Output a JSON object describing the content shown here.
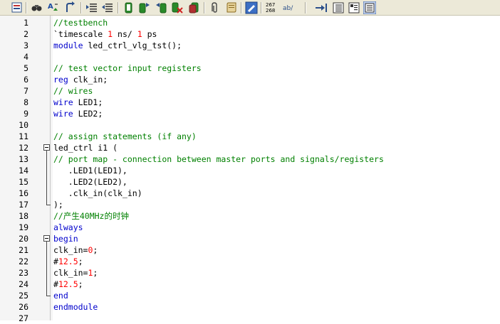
{
  "toolbar": {
    "buttons": [
      {
        "name": "insert-template-icon"
      },
      {
        "name": "find-icon"
      },
      {
        "name": "find-replace-icon"
      },
      {
        "name": "goto-line-icon"
      },
      {
        "name": "indent-icon"
      },
      {
        "name": "unindent-icon"
      },
      {
        "name": "bookmark-toggle-icon"
      },
      {
        "name": "bookmark-next-icon"
      },
      {
        "name": "bookmark-prev-icon"
      },
      {
        "name": "bookmark-clear-icon"
      },
      {
        "name": "bookmark-list-icon"
      },
      {
        "name": "attach-icon"
      },
      {
        "name": "scroll-icon"
      },
      {
        "name": "edit-icon"
      },
      {
        "name": "line-numbers-icon",
        "text_top": "267",
        "text_bottom": "268"
      },
      {
        "name": "whitespace-icon",
        "text": "ab/"
      },
      {
        "name": "comment-icon"
      },
      {
        "name": "uncomment-icon"
      },
      {
        "name": "expand-icon"
      },
      {
        "name": "collapse-icon"
      }
    ]
  },
  "editor": {
    "lines": [
      {
        "n": "1",
        "parts": [
          {
            "t": "//testbench",
            "c": "cm"
          }
        ]
      },
      {
        "n": "2",
        "parts": [
          {
            "t": "`timescale ",
            "c": ""
          },
          {
            "t": "1",
            "c": "num"
          },
          {
            "t": " ns/ ",
            "c": ""
          },
          {
            "t": "1",
            "c": "num"
          },
          {
            "t": " ps",
            "c": ""
          }
        ]
      },
      {
        "n": "3",
        "parts": [
          {
            "t": "module",
            "c": "kw"
          },
          {
            "t": " led_ctrl_vlg_tst();",
            "c": ""
          }
        ]
      },
      {
        "n": "4",
        "parts": []
      },
      {
        "n": "5",
        "parts": [
          {
            "t": "// test vector input registers",
            "c": "cm"
          }
        ]
      },
      {
        "n": "6",
        "parts": [
          {
            "t": "reg",
            "c": "kw"
          },
          {
            "t": " clk_in;",
            "c": ""
          }
        ]
      },
      {
        "n": "7",
        "parts": [
          {
            "t": "// wires",
            "c": "cm"
          }
        ]
      },
      {
        "n": "8",
        "parts": [
          {
            "t": "wire",
            "c": "kw"
          },
          {
            "t": " LED1;",
            "c": ""
          }
        ]
      },
      {
        "n": "9",
        "parts": [
          {
            "t": "wire",
            "c": "kw"
          },
          {
            "t": " LED2;",
            "c": ""
          }
        ]
      },
      {
        "n": "10",
        "parts": []
      },
      {
        "n": "11",
        "parts": [
          {
            "t": "// assign statements (if any)",
            "c": "cm"
          }
        ]
      },
      {
        "n": "12",
        "parts": [
          {
            "t": "led_ctrl i1 (",
            "c": ""
          }
        ]
      },
      {
        "n": "13",
        "parts": [
          {
            "t": "// port map - connection between master ports and signals/registers",
            "c": "cm"
          }
        ]
      },
      {
        "n": "14",
        "parts": [
          {
            "t": "   .LED1(LED1),",
            "c": ""
          }
        ]
      },
      {
        "n": "15",
        "parts": [
          {
            "t": "   .LED2(LED2),",
            "c": ""
          }
        ]
      },
      {
        "n": "16",
        "parts": [
          {
            "t": "   .clk_in(clk_in)",
            "c": ""
          }
        ]
      },
      {
        "n": "17",
        "parts": [
          {
            "t": ");",
            "c": ""
          }
        ]
      },
      {
        "n": "18",
        "parts": [
          {
            "t": "//产生40MHz的时钟",
            "c": "cm"
          }
        ]
      },
      {
        "n": "19",
        "parts": [
          {
            "t": "always",
            "c": "kw"
          }
        ]
      },
      {
        "n": "20",
        "parts": [
          {
            "t": "begin",
            "c": "kw"
          }
        ]
      },
      {
        "n": "21",
        "parts": [
          {
            "t": "clk_in=",
            "c": ""
          },
          {
            "t": "0",
            "c": "num"
          },
          {
            "t": ";",
            "c": ""
          }
        ]
      },
      {
        "n": "22",
        "parts": [
          {
            "t": "#",
            "c": ""
          },
          {
            "t": "12.5",
            "c": "num"
          },
          {
            "t": ";",
            "c": ""
          }
        ]
      },
      {
        "n": "23",
        "parts": [
          {
            "t": "clk_in=",
            "c": ""
          },
          {
            "t": "1",
            "c": "num"
          },
          {
            "t": ";",
            "c": ""
          }
        ]
      },
      {
        "n": "24",
        "parts": [
          {
            "t": "#",
            "c": ""
          },
          {
            "t": "12.5",
            "c": "num"
          },
          {
            "t": ";",
            "c": ""
          }
        ]
      },
      {
        "n": "25",
        "parts": [
          {
            "t": "end",
            "c": "kw"
          }
        ]
      },
      {
        "n": "26",
        "parts": [
          {
            "t": "endmodule",
            "c": "kw"
          }
        ]
      },
      {
        "n": "27",
        "parts": []
      }
    ],
    "folds": [
      {
        "start_line": "12",
        "end_line": "17"
      },
      {
        "start_line": "20",
        "end_line": "25"
      }
    ]
  }
}
